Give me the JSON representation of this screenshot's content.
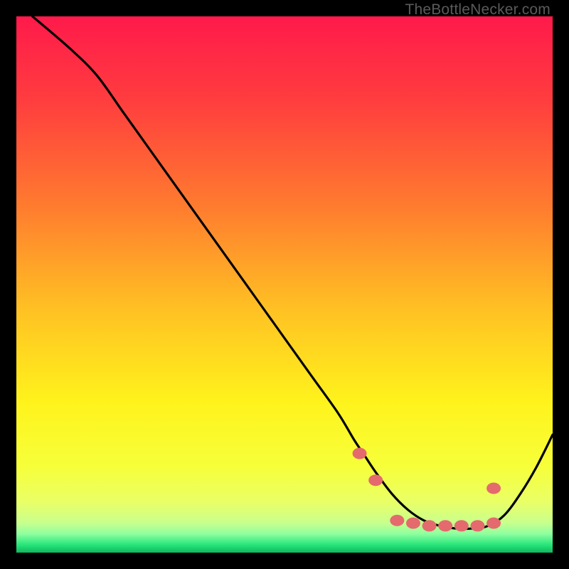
{
  "watermark": "TheBottleNecker.com",
  "chart_data": {
    "type": "line",
    "title": "",
    "xlabel": "",
    "ylabel": "",
    "xlim": [
      0,
      100
    ],
    "ylim": [
      0,
      100
    ],
    "grid": false,
    "series": [
      {
        "name": "curve",
        "x": [
          3,
          10,
          15,
          20,
          25,
          30,
          35,
          40,
          45,
          50,
          55,
          60,
          63,
          65,
          67,
          70,
          73,
          76,
          79,
          82,
          85,
          88,
          91,
          94,
          97,
          100
        ],
        "y": [
          100,
          94,
          89,
          82,
          75,
          68,
          61,
          54,
          47,
          40,
          33,
          26,
          21,
          18,
          15,
          11,
          8,
          6,
          5,
          4.5,
          4.5,
          5,
          7,
          11,
          16,
          22
        ]
      }
    ],
    "markers": {
      "name": "highlight-dots",
      "x": [
        64,
        67,
        71,
        74,
        77,
        80,
        83,
        86,
        89,
        89
      ],
      "y": [
        18.5,
        13.5,
        6,
        5.5,
        5,
        5,
        5,
        5,
        5.5,
        12
      ]
    },
    "gradient_stops": [
      {
        "offset": 0.0,
        "color": "#ff1a4b"
      },
      {
        "offset": 0.15,
        "color": "#ff3b3f"
      },
      {
        "offset": 0.35,
        "color": "#ff7a2f"
      },
      {
        "offset": 0.55,
        "color": "#ffc223"
      },
      {
        "offset": 0.72,
        "color": "#fff31c"
      },
      {
        "offset": 0.84,
        "color": "#f6ff3a"
      },
      {
        "offset": 0.905,
        "color": "#eaff66"
      },
      {
        "offset": 0.945,
        "color": "#c8ff8e"
      },
      {
        "offset": 0.965,
        "color": "#8effa0"
      },
      {
        "offset": 0.985,
        "color": "#28e67a"
      },
      {
        "offset": 1.0,
        "color": "#0fb85f"
      }
    ],
    "marker_color": "#e46a6e",
    "curve_color": "#000000"
  }
}
